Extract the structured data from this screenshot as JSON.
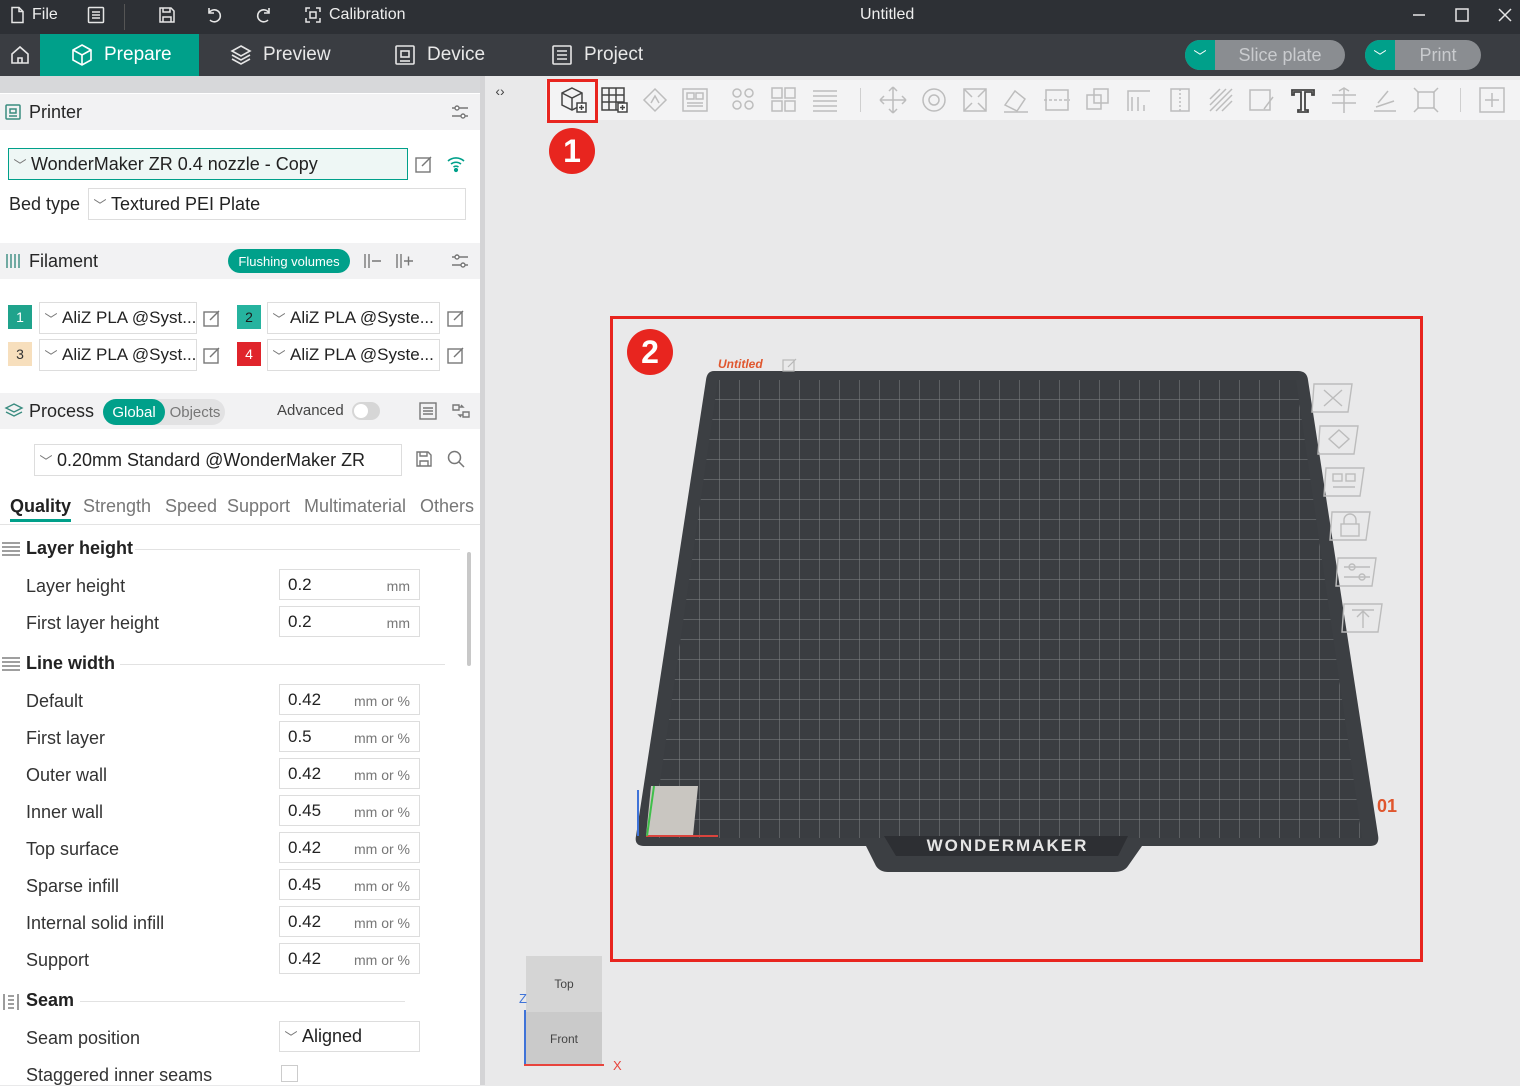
{
  "title_bar": {
    "file_label": "File",
    "calibration_label": "Calibration",
    "window_title": "Untitled"
  },
  "nav": {
    "tabs": [
      "Prepare",
      "Preview",
      "Device",
      "Project"
    ],
    "slice_label": "Slice plate",
    "print_label": "Print"
  },
  "printer": {
    "section_label": "Printer",
    "selected": "WonderMaker ZR 0.4 nozzle - Copy",
    "bed_type_label": "Bed type",
    "bed_type_value": "Textured PEI Plate"
  },
  "filament": {
    "section_label": "Filament",
    "flushing_label": "Flushing volumes",
    "slots": [
      {
        "num": "1",
        "name": "AliZ PLA @Syst...",
        "color": "#1fa38c",
        "text_color": "#ffffff"
      },
      {
        "num": "2",
        "name": "AliZ PLA @Syste...",
        "color": "#26b39f",
        "text_color": "#1b1b1b"
      },
      {
        "num": "3",
        "name": "AliZ PLA @Syst...",
        "color": "#f7dfbd",
        "text_color": "#333333"
      },
      {
        "num": "4",
        "name": "AliZ PLA @Syste...",
        "color": "#e0242b",
        "text_color": "#ffffff"
      }
    ]
  },
  "process": {
    "section_label": "Process",
    "global_label": "Global",
    "objects_label": "Objects",
    "advanced_label": "Advanced",
    "preset": "0.20mm Standard @WonderMaker ZR"
  },
  "tabs": [
    "Quality",
    "Strength",
    "Speed",
    "Support",
    "Multimaterial",
    "Others"
  ],
  "quality": {
    "layer_height_group": "Layer height",
    "layer_height": {
      "label": "Layer height",
      "value": "0.2",
      "unit": "mm"
    },
    "first_layer_height": {
      "label": "First layer height",
      "value": "0.2",
      "unit": "mm"
    },
    "line_width_group": "Line width",
    "line_widths": [
      {
        "label": "Default",
        "value": "0.42",
        "unit": "mm or %"
      },
      {
        "label": "First layer",
        "value": "0.5",
        "unit": "mm or %"
      },
      {
        "label": "Outer wall",
        "value": "0.42",
        "unit": "mm or %"
      },
      {
        "label": "Inner wall",
        "value": "0.45",
        "unit": "mm or %"
      },
      {
        "label": "Top surface",
        "value": "0.42",
        "unit": "mm or %"
      },
      {
        "label": "Sparse infill",
        "value": "0.45",
        "unit": "mm or %"
      },
      {
        "label": "Internal solid infill",
        "value": "0.42",
        "unit": "mm or %"
      },
      {
        "label": "Support",
        "value": "0.42",
        "unit": "mm or %"
      }
    ],
    "seam_group": "Seam",
    "seam_position": {
      "label": "Seam position",
      "value": "Aligned"
    },
    "staggered_label": "Staggered inner seams"
  },
  "plate": {
    "name": "Untitled",
    "number": "01",
    "brand": "WONDERMAKER"
  },
  "annotations": [
    "1",
    "2"
  ],
  "view_cube": {
    "top": "Top",
    "front": "Front",
    "z_axis": "Z",
    "x_axis": "X"
  },
  "colors": {
    "accent": "#00a08a",
    "annotation": "#e8251f"
  }
}
